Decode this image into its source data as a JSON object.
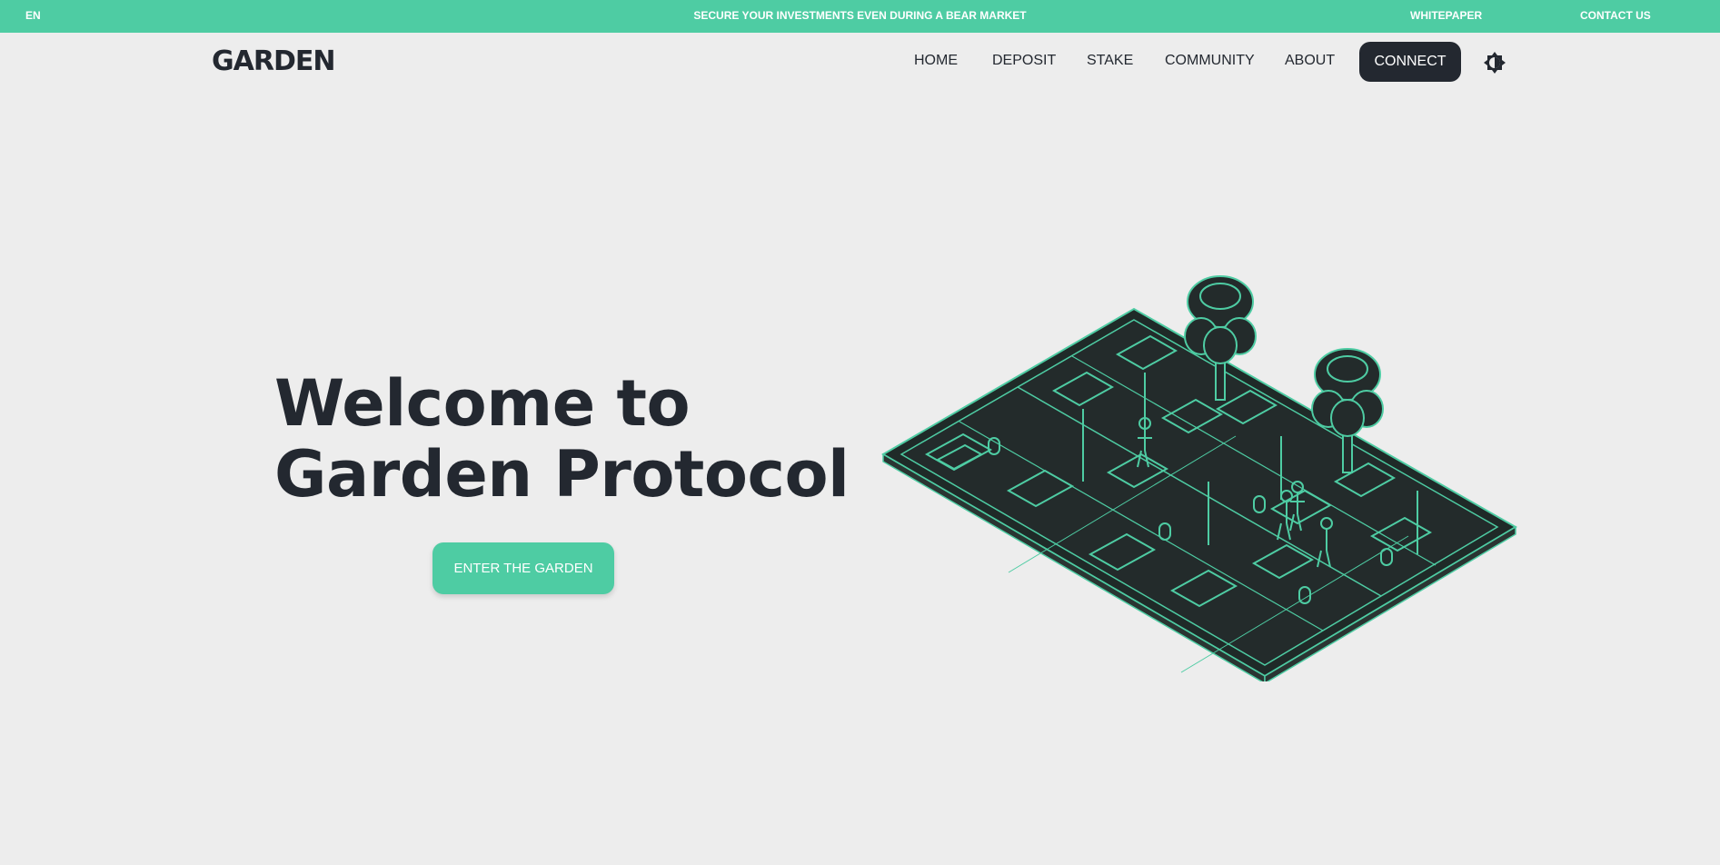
{
  "topbar": {
    "language": "EN",
    "promo": "SECURE YOUR INVESTMENTS EVEN DURING A BEAR MARKET",
    "whitepaper": "WHITEPAPER",
    "contact": "CONTACT US"
  },
  "nav": {
    "logo": "GARDEN",
    "items": [
      "HOME",
      "DEPOSIT",
      "STAKE",
      "COMMUNITY",
      "ABOUT"
    ],
    "connect": "CONNECT",
    "theme_icon": "theme-toggle-icon"
  },
  "hero": {
    "title_line1": "Welcome to",
    "title_line2": "Garden Protocol",
    "cta": "ENTER THE GARDEN",
    "illustration": "isometric-garden-illustration"
  },
  "colors": {
    "accent": "#4ecca3",
    "dark": "#232830",
    "background": "#ededed"
  }
}
